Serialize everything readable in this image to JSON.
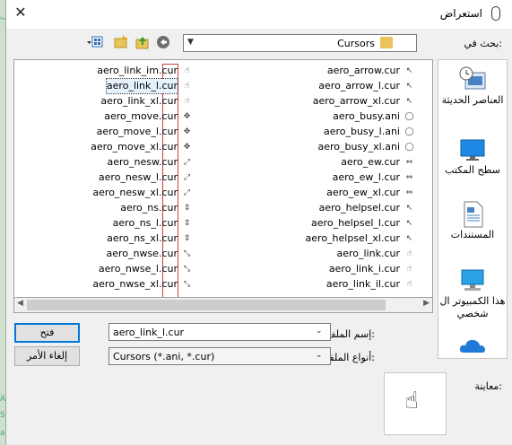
{
  "background": {
    "fragments": [
      "ف",
      "A",
      "S",
      "a"
    ]
  },
  "window": {
    "title": "استعراض",
    "close_symbol": "✕"
  },
  "look_in": {
    "label": "بحث في:",
    "value": "Cursors"
  },
  "files": {
    "right_column": [
      {
        "name": "aero_arrow.cur",
        "icon": "arrow-cursor-icon",
        "glyph": "↖"
      },
      {
        "name": "aero_arrow_l.cur",
        "icon": "arrow-cursor-icon",
        "glyph": "↖"
      },
      {
        "name": "aero_arrow_xl.cur",
        "icon": "arrow-cursor-icon",
        "glyph": "↖"
      },
      {
        "name": "aero_busy.ani",
        "icon": "busy-ring-icon",
        "glyph": "◯"
      },
      {
        "name": "aero_busy_l.ani",
        "icon": "busy-ring-icon",
        "glyph": "◯"
      },
      {
        "name": "aero_busy_xl.ani",
        "icon": "busy-ring-icon",
        "glyph": "◯"
      },
      {
        "name": "aero_ew.cur",
        "icon": "ew-resize-icon",
        "glyph": "⇔"
      },
      {
        "name": "aero_ew_l.cur",
        "icon": "ew-resize-icon",
        "glyph": "⇔"
      },
      {
        "name": "aero_ew_xl.cur",
        "icon": "ew-resize-icon",
        "glyph": "⇔"
      },
      {
        "name": "aero_helpsel.cur",
        "icon": "help-select-icon",
        "glyph": "↖"
      },
      {
        "name": "aero_helpsel_l.cur",
        "icon": "help-select-icon",
        "glyph": "↖"
      },
      {
        "name": "aero_helpsel_xl.cur",
        "icon": "help-select-icon",
        "glyph": "↖"
      },
      {
        "name": "aero_link.cur",
        "icon": "hand-cursor-icon",
        "glyph": "☝"
      },
      {
        "name": "aero_link_i.cur",
        "icon": "hand-cursor-icon",
        "glyph": "☝"
      },
      {
        "name": "aero_link_il.cur",
        "icon": "hand-cursor-icon",
        "glyph": "☝"
      }
    ],
    "left_column": [
      {
        "name": "aero_link_im.cur",
        "icon": "hand-cursor-icon",
        "glyph": "☝"
      },
      {
        "name": "aero_link_l.cur",
        "icon": "hand-cursor-icon",
        "glyph": "☝",
        "selected": true
      },
      {
        "name": "aero_link_xl.cur",
        "icon": "hand-cursor-icon",
        "glyph": "☝"
      },
      {
        "name": "aero_move.cur",
        "icon": "move-cursor-icon",
        "glyph": "✥"
      },
      {
        "name": "aero_move_l.cur",
        "icon": "move-cursor-icon",
        "glyph": "✥"
      },
      {
        "name": "aero_move_xl.cur",
        "icon": "move-cursor-icon",
        "glyph": "✥"
      },
      {
        "name": "aero_nesw.cur",
        "icon": "nesw-resize-icon",
        "glyph": "⤢"
      },
      {
        "name": "aero_nesw_l.cur",
        "icon": "nesw-resize-icon",
        "glyph": "⤢"
      },
      {
        "name": "aero_nesw_xl.cur",
        "icon": "nesw-resize-icon",
        "glyph": "⤢"
      },
      {
        "name": "aero_ns.cur",
        "icon": "ns-resize-icon",
        "glyph": "⇕"
      },
      {
        "name": "aero_ns_l.cur",
        "icon": "ns-resize-icon",
        "glyph": "⇕"
      },
      {
        "name": "aero_ns_xl.cur",
        "icon": "ns-resize-icon",
        "glyph": "⇕"
      },
      {
        "name": "aero_nwse.cur",
        "icon": "nwse-resize-icon",
        "glyph": "⤡"
      },
      {
        "name": "aero_nwse_l.cur",
        "icon": "nwse-resize-icon",
        "glyph": "⤡"
      },
      {
        "name": "aero_nwse_xl.cur",
        "icon": "nwse-resize-icon",
        "glyph": "⤡"
      }
    ]
  },
  "places": [
    {
      "label": "العناصر الحديثة",
      "icon": "recent-items-icon"
    },
    {
      "label": "سطح المكتب",
      "icon": "desktop-icon"
    },
    {
      "label": "المستندات",
      "icon": "documents-icon"
    },
    {
      "label": "هذا الكمبيوتر ال شخصي",
      "icon": "this-pc-icon"
    },
    {
      "label": "",
      "icon": "onedrive-icon"
    }
  ],
  "filename": {
    "label": "إسم الملف:",
    "value": "aero_link_l.cur"
  },
  "filetype": {
    "label": "أنواع الملفات:",
    "value": "Cursors (*.ani, *.cur)"
  },
  "buttons": {
    "open": "فتح",
    "cancel": "إلغاء الأمر"
  },
  "preview": {
    "label": "معاينة:",
    "glyph": "☝"
  },
  "colors": {
    "accent": "#0078d7",
    "selection_bg": "#e5f1fb",
    "marker_red": "#d23a3a"
  }
}
